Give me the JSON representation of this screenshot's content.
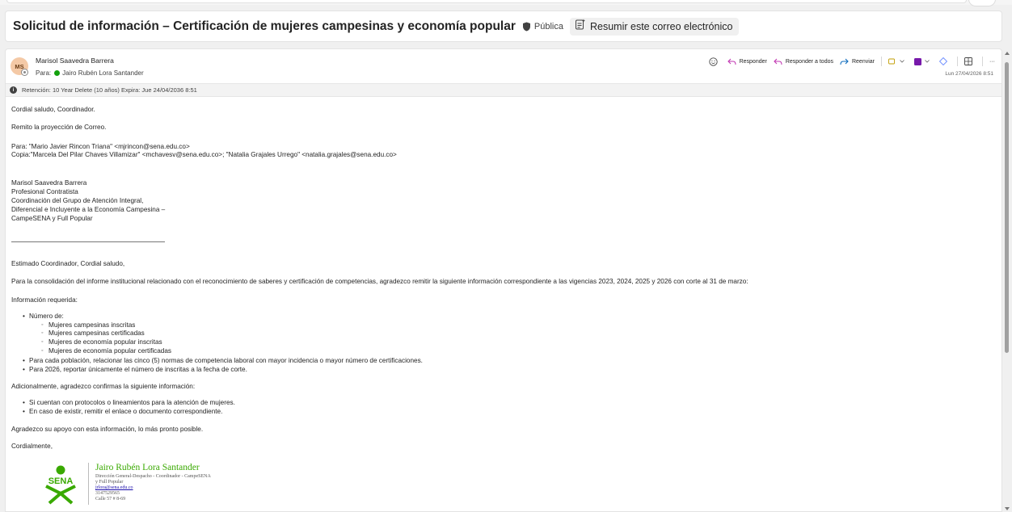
{
  "subject": {
    "title": "Solicitud de información – Certificación de mujeres campesinas y economía popular",
    "visibility": "Pública",
    "summarize_label": "Resumir este correo electrónico"
  },
  "header": {
    "avatar_initials": "MS",
    "sender": "Marisol Saavedra Barrera",
    "to_label": "Para:",
    "to_name": "Jairo Rubén Lora Santander",
    "date": "Lun 27/04/2026 8:51",
    "actions": {
      "reply": "Responder",
      "reply_all": "Responder a todos",
      "forward": "Reenviar",
      "more": "···"
    }
  },
  "retention": "Retención: 10 Year Delete (10 años) Expira: Jue 24/04/2036 8:51",
  "body": {
    "greeting": "Cordial saludo, Coordinador.",
    "intro": "Remito la proyección de Correo.",
    "para_line": "Para: \"Mario Javier Rincon Triana\" <mjrincon@sena.edu.co>",
    "copia_line": "Copia:\"Marcela Del Pilar Chaves Villamizar\" <mchavesv@sena.edu.co>; \"Natalia Grajales  Urrego\" <natalia.grajales@sena.edu.co>",
    "sig_block": [
      "Marisol Saavedra Barrera",
      "Profesional Contratista",
      "Coordinación del Grupo de Atención Integral,",
      "Diferencial e Incluyente a la Economía Campesina –",
      "CampeSENA y Full Popular"
    ],
    "estimado": "Estimado Coordinador, Cordial saludo,",
    "consolidacion": "Para la consolidación del informe institucional relacionado con el reconocimiento de saberes y certificación de competencias, agradezco remitir la siguiente información correspondiente a las vigencias 2023, 2024, 2025 y 2026 con corte al 31 de marzo:",
    "info_requerida": "Información requerida:",
    "numero_de": "Número de:",
    "sub_items": [
      "Mujeres campesinas inscritas",
      "Mujeres campesinas certificadas",
      "Mujeres de economía popular inscritas",
      "Mujeres de economía popular certificadas"
    ],
    "bullet_2": "Para cada población, relacionar las cinco (5) normas de competencia laboral con mayor incidencia o mayor número de certificaciones.",
    "bullet_3": "Para 2026, reportar únicamente el número de inscritas a la fecha de corte.",
    "adicional": "Adicionalmente, agradezco confirmas la siguiente información:",
    "adicional_items": [
      "Si cuentan con protocolos o lineamientos para la atención de mujeres.",
      "En caso de existir, remitir el enlace o documento correspondiente."
    ],
    "agradezco": "Agradezco su apoyo con esta información, lo más pronto posible.",
    "cordialmente": "Cordialmente,"
  },
  "signature": {
    "logo_text": "SENA",
    "name": "Jairo Rubén Lora Santander",
    "line1": "Dirección General-Despacho - Coordinador - CampeSENA",
    "line2": "y Full Popular",
    "email": "jrlora@sena.edu.co",
    "phone": "3147529565",
    "address": "Calle 57 # 8-69"
  },
  "colors": {
    "sena_green": "#39a900",
    "accent_blue": "#0f6cbd",
    "presence_green": "#13a10e"
  }
}
